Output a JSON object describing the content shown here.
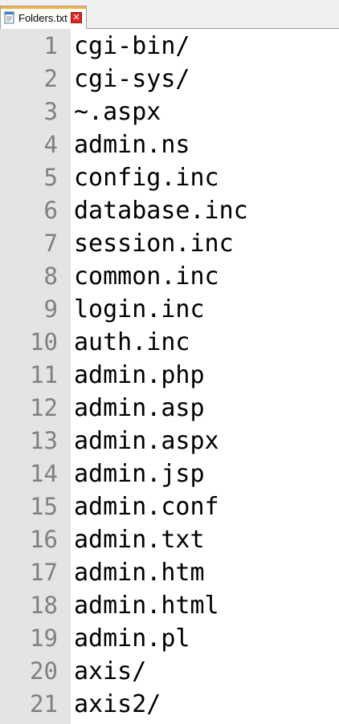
{
  "tab": {
    "label": "Folders.txt",
    "close_glyph": "✕",
    "icon": "text-file-icon"
  },
  "colors": {
    "gutter_bg": "#e4e4e4",
    "line_number": "#808080",
    "text": "#000000",
    "tab_accent": "#f7b343",
    "close_button": "#d7281f"
  },
  "lines": [
    {
      "num": "1",
      "text": "cgi-bin/"
    },
    {
      "num": "2",
      "text": "cgi-sys/"
    },
    {
      "num": "3",
      "text": "~.aspx"
    },
    {
      "num": "4",
      "text": "admin.ns"
    },
    {
      "num": "5",
      "text": "config.inc"
    },
    {
      "num": "6",
      "text": "database.inc"
    },
    {
      "num": "7",
      "text": "session.inc"
    },
    {
      "num": "8",
      "text": "common.inc"
    },
    {
      "num": "9",
      "text": "login.inc"
    },
    {
      "num": "10",
      "text": "auth.inc"
    },
    {
      "num": "11",
      "text": "admin.php"
    },
    {
      "num": "12",
      "text": "admin.asp"
    },
    {
      "num": "13",
      "text": "admin.aspx"
    },
    {
      "num": "14",
      "text": "admin.jsp"
    },
    {
      "num": "15",
      "text": "admin.conf"
    },
    {
      "num": "16",
      "text": "admin.txt"
    },
    {
      "num": "17",
      "text": "admin.htm"
    },
    {
      "num": "18",
      "text": "admin.html"
    },
    {
      "num": "19",
      "text": "admin.pl"
    },
    {
      "num": "20",
      "text": "axis/"
    },
    {
      "num": "21",
      "text": "axis2/"
    }
  ]
}
